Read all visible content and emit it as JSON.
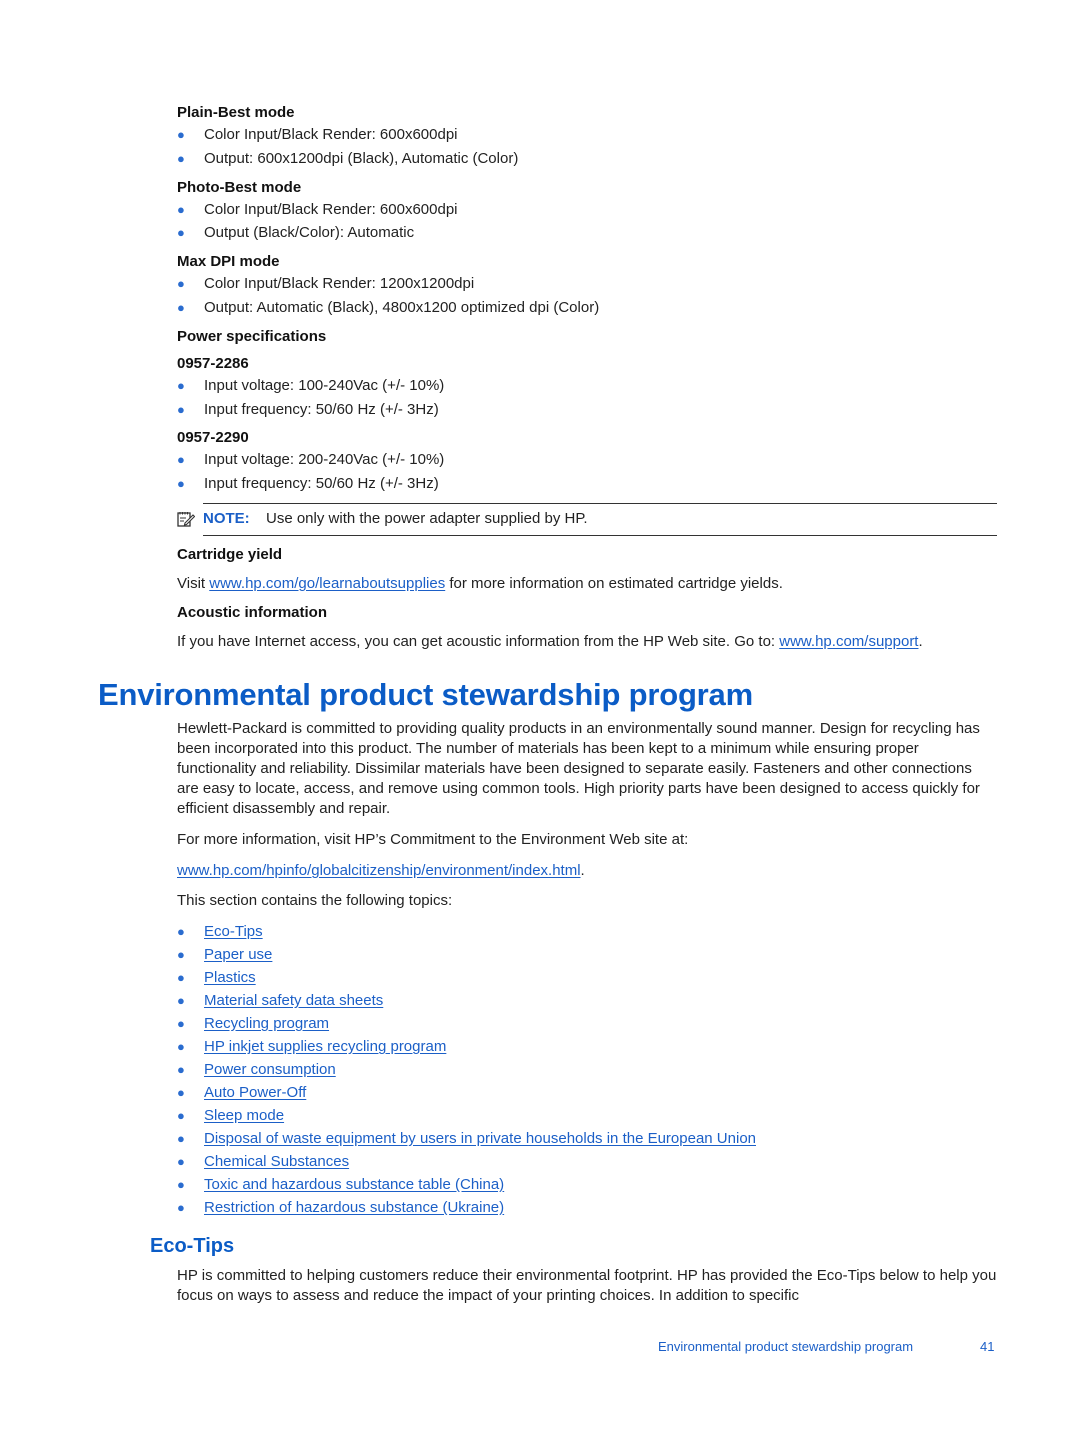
{
  "specs": {
    "plain_best": {
      "heading": "Plain-Best mode",
      "items": [
        "Color Input/Black Render: 600x600dpi",
        "Output: 600x1200dpi (Black), Automatic (Color)"
      ]
    },
    "photo_best": {
      "heading": "Photo-Best mode",
      "items": [
        "Color Input/Black Render: 600x600dpi",
        "Output (Black/Color): Automatic"
      ]
    },
    "max_dpi": {
      "heading": "Max DPI mode",
      "items": [
        "Color Input/Black Render: 1200x1200dpi",
        "Output: Automatic (Black), 4800x1200 optimized dpi (Color)"
      ]
    }
  },
  "power": {
    "heading": "Power specifications",
    "models": [
      {
        "id": "0957-2286",
        "items": [
          "Input voltage: 100-240Vac (+/- 10%)",
          "Input frequency: 50/60 Hz (+/- 3Hz)"
        ]
      },
      {
        "id": "0957-2290",
        "items": [
          "Input voltage: 200-240Vac (+/- 10%)",
          "Input frequency: 50/60 Hz (+/- 3Hz)"
        ]
      }
    ],
    "note": {
      "icon": "note-pencil-icon",
      "label": "NOTE:",
      "text": "Use only with the power adapter supplied by HP."
    }
  },
  "cartridge": {
    "heading": "Cartridge yield",
    "prefix": "Visit ",
    "link": "www.hp.com/go/learnaboutsupplies",
    "suffix": " for more information on estimated cartridge yields."
  },
  "acoustic": {
    "heading": "Acoustic information",
    "prefix": "If you have Internet access, you can get acoustic information from the HP Web site. Go to: ",
    "link": "www.hp.com/support",
    "suffix": "."
  },
  "environment": {
    "title": "Environmental product stewardship program",
    "intro": "Hewlett-Packard is committed to providing quality products in an environmentally sound manner. Design for recycling has been incorporated into this product. The number of materials has been kept to a minimum while ensuring proper functionality and reliability. Dissimilar materials have been designed to separate easily. Fasteners and other connections are easy to locate, access, and remove using common tools. High priority parts have been designed to access quickly for efficient disassembly and repair.",
    "more_info": "For more information, visit HP’s Commitment to the Environment Web site at:",
    "more_info_link": "www.hp.com/hpinfo/globalcitizenship/environment/index.html",
    "more_info_suffix": ".",
    "topics_intro": "This section contains the following topics:",
    "topics": [
      "Eco-Tips",
      "Paper use",
      "Plastics",
      "Material safety data sheets",
      "Recycling program",
      "HP inkjet supplies recycling program",
      "Power consumption",
      "Auto Power-Off",
      "Sleep mode",
      "Disposal of waste equipment by users in private households in the European Union",
      "Chemical Substances",
      "Toxic and hazardous substance table (China)",
      "Restriction of hazardous substance (Ukraine)"
    ]
  },
  "eco_tips": {
    "heading": "Eco-Tips",
    "text": "HP is committed to helping customers reduce their environmental footprint. HP has provided the Eco-Tips below to help you focus on ways to assess and reduce the impact of your printing choices. In addition to specific"
  },
  "footer": {
    "section": "Environmental product stewardship program",
    "page": "41"
  }
}
